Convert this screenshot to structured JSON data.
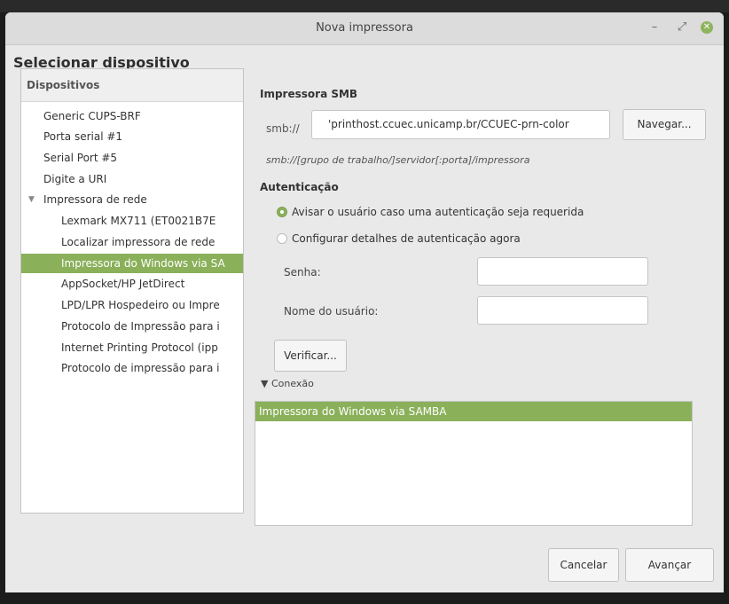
{
  "window": {
    "title": "Nova impressora",
    "minimize": "–",
    "maximize": "⤢",
    "close": "✕"
  },
  "heading": "Selecionar dispositivo",
  "devices": {
    "header": "Dispositivos",
    "items": [
      "Generic CUPS-BRF",
      "Porta serial #1",
      "Serial Port #5",
      "Digite a URI",
      "Impressora de rede",
      "Lexmark MX711 (ET0021B7E",
      "Localizar impressora de rede",
      "Impressora do Windows via SA",
      "AppSocket/HP JetDirect",
      "LPD/LPR Hospedeiro ou Impre",
      "Protocolo de Impressão para i",
      "Internet Printing Protocol (ipp",
      "Protocolo de impressão para i"
    ],
    "expander": "▼"
  },
  "smb": {
    "title": "Impressora SMB",
    "prefix": "smb://",
    "value": "'printhost.ccuec.unicamp.br/CCUEC-prn-color",
    "browse_label": "Navegar...",
    "hint": "smb://[grupo de trabalho/]servidor[:porta]/impressora"
  },
  "auth": {
    "title": "Autenticação",
    "option_prompt": "Avisar o usuário caso uma autenticação seja requerida",
    "option_now": "Configurar detalhes de autenticação agora",
    "password_label": "Senha:",
    "username_label": "Nome do usuário:",
    "verify_label": "Verificar..."
  },
  "connection": {
    "toggle": "▼ Conexão",
    "selected": "Impressora do Windows via SAMBA"
  },
  "footer": {
    "cancel": "Cancelar",
    "next": "Avançar"
  },
  "colors": {
    "accent": "#8ab05a",
    "window_bg": "#e9e9e9"
  }
}
